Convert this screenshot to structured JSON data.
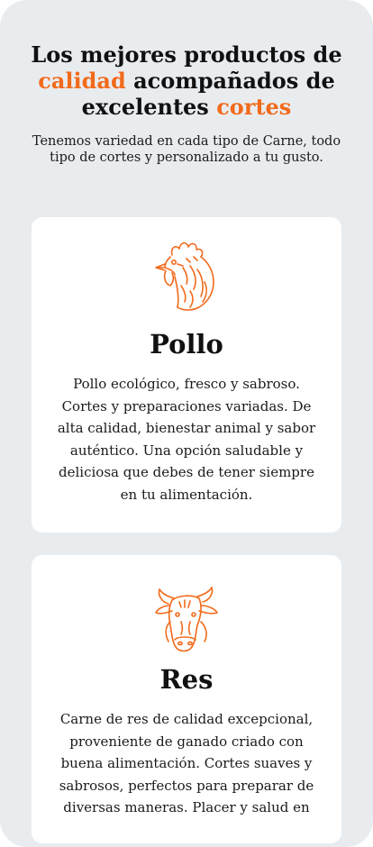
{
  "hero": {
    "title_part1": "Los mejores productos de ",
    "title_accent1": "calidad",
    "title_part2": " acompañados de excelentes ",
    "title_accent2": "cortes",
    "subtitle": "Tenemos variedad en cada tipo de Carne, todo tipo de cortes y personalizado a tu gusto."
  },
  "colors": {
    "accent": "#f26a1b",
    "background": "#e9ecef",
    "card": "#ffffff"
  },
  "cards": [
    {
      "icon": "chicken-icon",
      "title": "Pollo",
      "text": "Pollo ecológico, fresco y sabroso. Cortes y preparaciones variadas. De alta calidad, bienestar animal y sabor auténtico. Una opción saludable y deliciosa que debes de tener siempre en tu alimentación."
    },
    {
      "icon": "cow-icon",
      "title": "Res",
      "text": "Carne de res de calidad excepcional, proveniente de ganado criado con buena alimentación. Cortes suaves y sabrosos, perfectos para preparar de diversas maneras. Placer y salud en"
    }
  ]
}
